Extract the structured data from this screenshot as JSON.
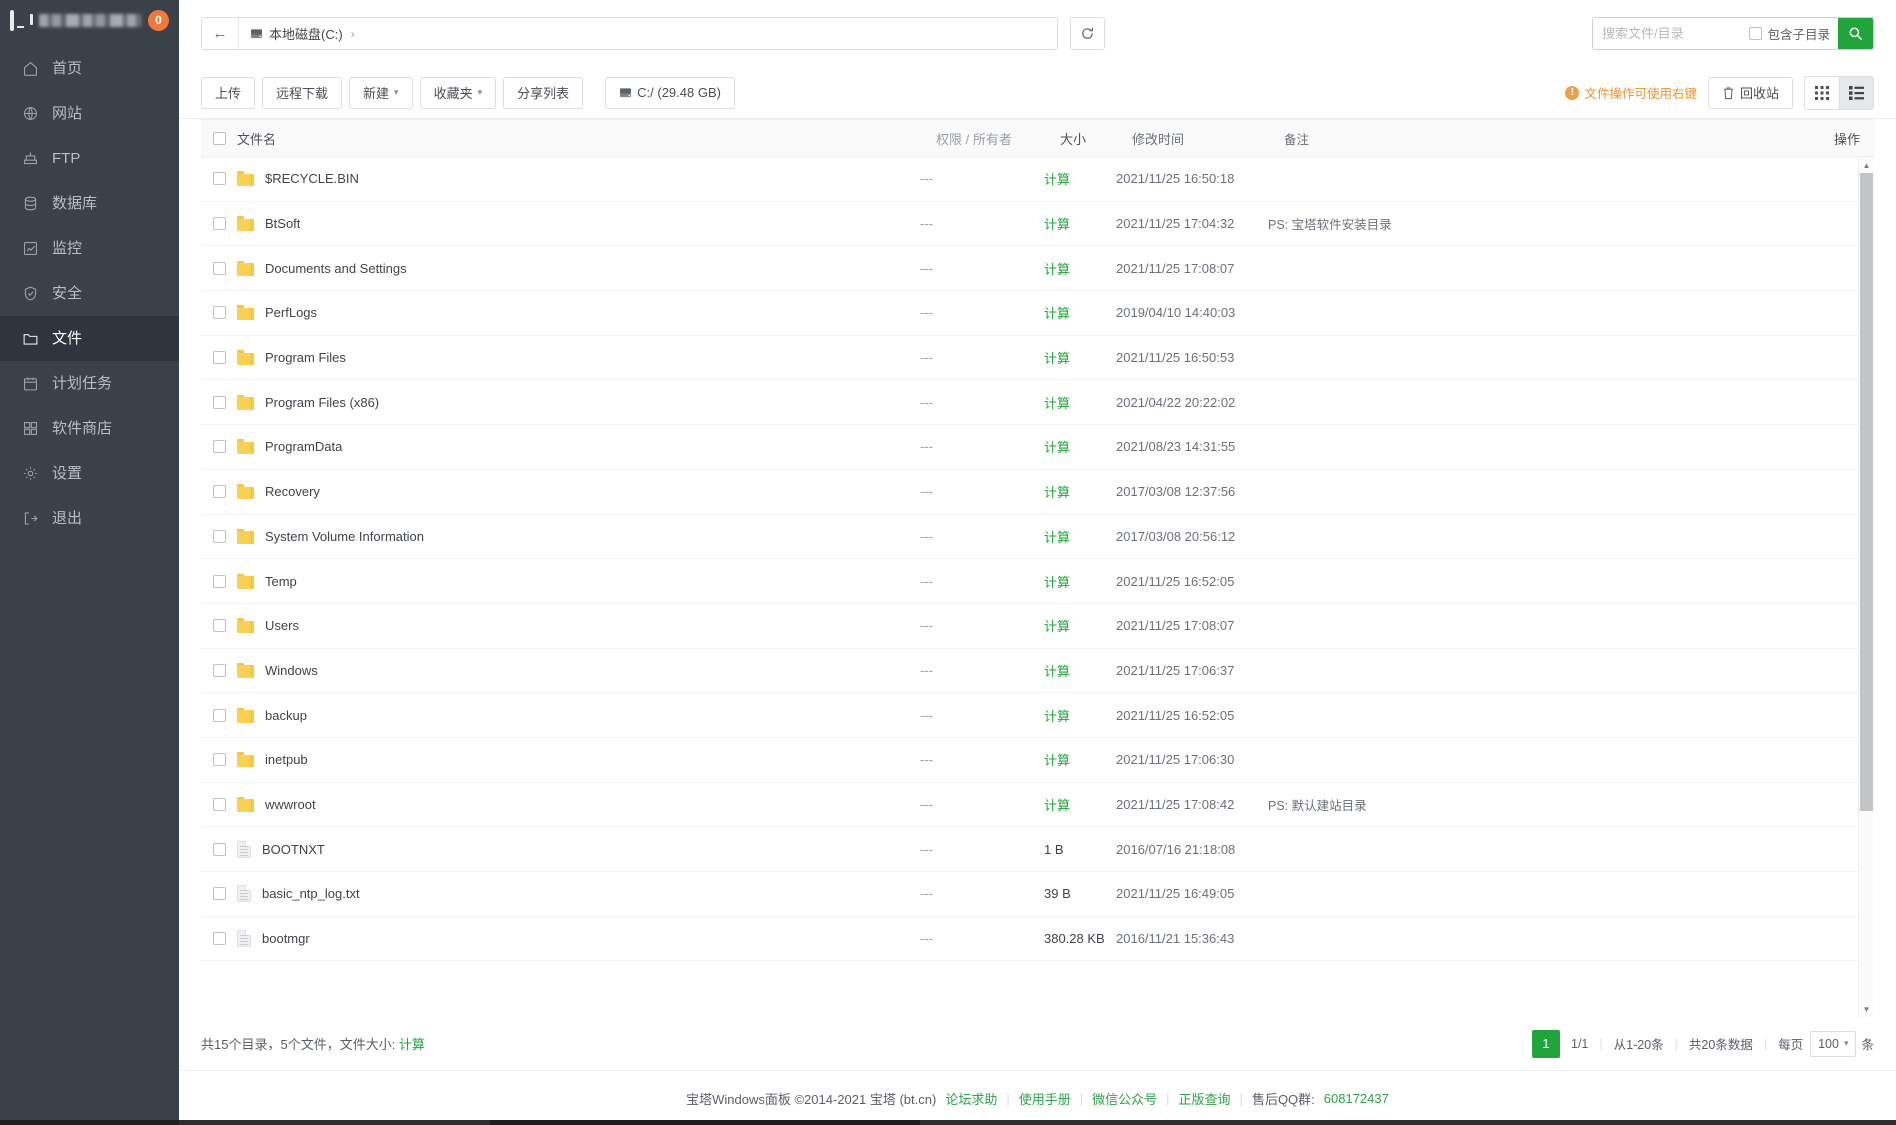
{
  "sidebar": {
    "brand": {
      "icon": "monitor-icon",
      "name_masked": "",
      "badge": "0"
    },
    "items": [
      {
        "icon": "home-icon",
        "label": "首页"
      },
      {
        "icon": "globe-icon",
        "label": "网站"
      },
      {
        "icon": "ftp-icon",
        "label": "FTP"
      },
      {
        "icon": "database-icon",
        "label": "数据库"
      },
      {
        "icon": "monitor-chart-icon",
        "label": "监控"
      },
      {
        "icon": "shield-icon",
        "label": "安全"
      },
      {
        "icon": "folder-icon",
        "label": "文件"
      },
      {
        "icon": "calendar-icon",
        "label": "计划任务"
      },
      {
        "icon": "apps-icon",
        "label": "软件商店"
      },
      {
        "icon": "gear-icon",
        "label": "设置"
      },
      {
        "icon": "logout-icon",
        "label": "退出"
      }
    ],
    "active_index": 6
  },
  "topbar": {
    "back_icon": "arrow-left-icon",
    "breadcrumb": {
      "disk_icon": "disk-icon",
      "label": "本地磁盘(C:)",
      "separator": "›"
    },
    "refresh_icon": "refresh-icon",
    "search": {
      "placeholder": "搜索文件/目录",
      "value": "",
      "subdir_label": "包含子目录",
      "subdir_checked": false,
      "button_icon": "search-icon"
    }
  },
  "toolbar": {
    "buttons": [
      {
        "label": "上传",
        "caret": false
      },
      {
        "label": "远程下载",
        "caret": false
      },
      {
        "label": "新建",
        "caret": true
      },
      {
        "label": "收藏夹",
        "caret": true
      },
      {
        "label": "分享列表",
        "caret": false
      }
    ],
    "disk_button": {
      "icon": "disk-icon",
      "label": "C:/ (29.48 GB)"
    },
    "hint": "文件操作可使用右键",
    "recycle": {
      "icon": "trash-icon",
      "label": "回收站"
    },
    "views": [
      {
        "name": "grid-view",
        "icon": "grid-icon",
        "active": false
      },
      {
        "name": "list-view",
        "icon": "list-icon",
        "active": true
      }
    ]
  },
  "table": {
    "columns": {
      "name": "文件名",
      "perm": "权限 / 所有者",
      "size": "大小",
      "time": "修改时间",
      "note": "备注",
      "ops": "操作"
    },
    "rows": [
      {
        "type": "folder",
        "name": "$RECYCLE.BIN",
        "perm": "---",
        "size": "计算",
        "size_link": true,
        "time": "2021/11/25 16:50:18",
        "note": ""
      },
      {
        "type": "folder",
        "name": "BtSoft",
        "perm": "---",
        "size": "计算",
        "size_link": true,
        "time": "2021/11/25 17:04:32",
        "note": "PS: 宝塔软件安装目录"
      },
      {
        "type": "folder",
        "name": "Documents and Settings",
        "perm": "---",
        "size": "计算",
        "size_link": true,
        "time": "2021/11/25 17:08:07",
        "note": ""
      },
      {
        "type": "folder",
        "name": "PerfLogs",
        "perm": "---",
        "size": "计算",
        "size_link": true,
        "time": "2019/04/10 14:40:03",
        "note": ""
      },
      {
        "type": "folder",
        "name": "Program Files",
        "perm": "---",
        "size": "计算",
        "size_link": true,
        "time": "2021/11/25 16:50:53",
        "note": ""
      },
      {
        "type": "folder",
        "name": "Program Files (x86)",
        "perm": "---",
        "size": "计算",
        "size_link": true,
        "time": "2021/04/22 20:22:02",
        "note": ""
      },
      {
        "type": "folder",
        "name": "ProgramData",
        "perm": "---",
        "size": "计算",
        "size_link": true,
        "time": "2021/08/23 14:31:55",
        "note": ""
      },
      {
        "type": "folder",
        "name": "Recovery",
        "perm": "---",
        "size": "计算",
        "size_link": true,
        "time": "2017/03/08 12:37:56",
        "note": ""
      },
      {
        "type": "folder",
        "name": "System Volume Information",
        "perm": "---",
        "size": "计算",
        "size_link": true,
        "time": "2017/03/08 20:56:12",
        "note": ""
      },
      {
        "type": "folder",
        "name": "Temp",
        "perm": "---",
        "size": "计算",
        "size_link": true,
        "time": "2021/11/25 16:52:05",
        "note": ""
      },
      {
        "type": "folder",
        "name": "Users",
        "perm": "---",
        "size": "计算",
        "size_link": true,
        "time": "2021/11/25 17:08:07",
        "note": ""
      },
      {
        "type": "folder",
        "name": "Windows",
        "perm": "---",
        "size": "计算",
        "size_link": true,
        "time": "2021/11/25 17:06:37",
        "note": ""
      },
      {
        "type": "folder",
        "name": "backup",
        "perm": "---",
        "size": "计算",
        "size_link": true,
        "time": "2021/11/25 16:52:05",
        "note": ""
      },
      {
        "type": "folder",
        "name": "inetpub",
        "perm": "---",
        "size": "计算",
        "size_link": true,
        "time": "2021/11/25 17:06:30",
        "note": ""
      },
      {
        "type": "folder",
        "name": "wwwroot",
        "perm": "---",
        "size": "计算",
        "size_link": true,
        "time": "2021/11/25 17:08:42",
        "note": "PS: 默认建站目录"
      },
      {
        "type": "file",
        "name": "BOOTNXT",
        "perm": "---",
        "size": "1 B",
        "size_link": false,
        "time": "2016/07/16 21:18:08",
        "note": ""
      },
      {
        "type": "file",
        "name": "basic_ntp_log.txt",
        "perm": "---",
        "size": "39 B",
        "size_link": false,
        "time": "2021/11/25 16:49:05",
        "note": ""
      },
      {
        "type": "file",
        "name": "bootmgr",
        "perm": "---",
        "size": "380.28 KB",
        "size_link": false,
        "time": "2016/11/21 15:36:43",
        "note": ""
      }
    ]
  },
  "footer_bar": {
    "summary_prefix": "共15个目录，5个文件，文件大小: ",
    "summary_calc": "计算",
    "pager": {
      "current_page": "1",
      "page_of": "1/1",
      "range": "从1-20条",
      "total": "共20条数据",
      "per_page_prefix": "每页",
      "per_page_value": "100",
      "per_page_suffix": "条"
    }
  },
  "page_footer": {
    "copyright": "宝塔Windows面板 ©2014-2021 宝塔 (bt.cn)",
    "links": [
      "论坛求助",
      "使用手册",
      "微信公众号",
      "正版查询"
    ],
    "qq_label": "售后QQ群:",
    "qq_value": "608172437",
    "divider": "|"
  },
  "colors": {
    "accent_green": "#20a53a",
    "sidebar_bg": "#3b4149",
    "badge_orange": "#f0793a",
    "hint_orange": "#f0902a"
  }
}
